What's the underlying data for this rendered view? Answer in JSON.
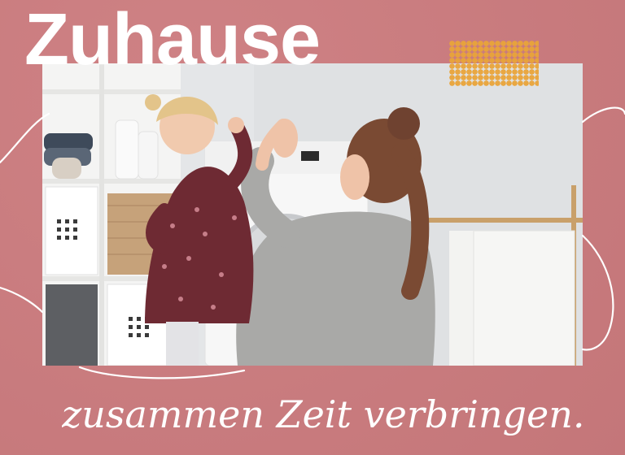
{
  "headline": "Zuhause",
  "tagline": "zusammen Zeit verbringen.",
  "colors": {
    "background": "#cc7b7e",
    "headline": "#ffffff",
    "accent_dots": "#e9a43a",
    "scribble": "#ffffff"
  },
  "photo": {
    "subject": "mother and daughter high-five in a laundry room",
    "image_icon": "photo-icon"
  }
}
